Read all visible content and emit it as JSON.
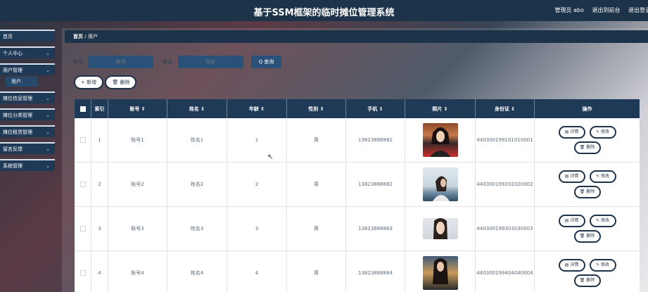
{
  "header": {
    "title": "基于SSM框架的临时摊位管理系统",
    "admin_label": "管理员 abo",
    "back_label": "退出到前台",
    "logout_label": "退出登录"
  },
  "sidebar": {
    "items": [
      {
        "label": "首页",
        "has_chevron": false
      },
      {
        "label": "个人中心",
        "has_chevron": true
      },
      {
        "label": "用户管理",
        "has_chevron": true
      },
      {
        "label": "摊位信息管理",
        "has_chevron": true
      },
      {
        "label": "摊位分类管理",
        "has_chevron": true
      },
      {
        "label": "摊位租赁管理",
        "has_chevron": true
      },
      {
        "label": "留言反馈",
        "has_chevron": true
      },
      {
        "label": "系统管理",
        "has_chevron": true
      }
    ],
    "sub_item": "用户"
  },
  "breadcrumb": {
    "home": "首页",
    "sep": "/",
    "current": "用户"
  },
  "search": {
    "account_label": "账号",
    "account_placeholder": "账号",
    "name_label": "姓名",
    "name_placeholder": "姓名",
    "query_label": "Q 查询"
  },
  "actions": {
    "add_label": "+ 新增",
    "delete_label": "删除"
  },
  "table": {
    "headers": [
      "索引",
      "账号 ⇕",
      "姓名 ⇕",
      "年龄 ⇕",
      "性别 ⇕",
      "手机 ⇕",
      "照片 ⇕",
      "身份证 ⇕",
      "操作"
    ],
    "rows": [
      {
        "index": "1",
        "account": "账号1",
        "name": "姓名1",
        "age": "1",
        "gender": "男",
        "phone": "13823888881",
        "id_card": "440300199101010001"
      },
      {
        "index": "2",
        "account": "账号2",
        "name": "姓名2",
        "age": "2",
        "gender": "男",
        "phone": "13823888882",
        "id_card": "440300199202020002"
      },
      {
        "index": "3",
        "account": "账号3",
        "name": "姓名3",
        "age": "3",
        "gender": "男",
        "phone": "13823888883",
        "id_card": "440300199303030003"
      },
      {
        "index": "4",
        "account": "账号4",
        "name": "姓名4",
        "age": "4",
        "gender": "男",
        "phone": "13823888884",
        "id_card": "440300199404040004"
      }
    ],
    "op_detail": "详情",
    "op_edit": "修改",
    "op_delete": "删除"
  },
  "colors": {
    "primary": "#1d3349",
    "input": "#2a5279"
  }
}
